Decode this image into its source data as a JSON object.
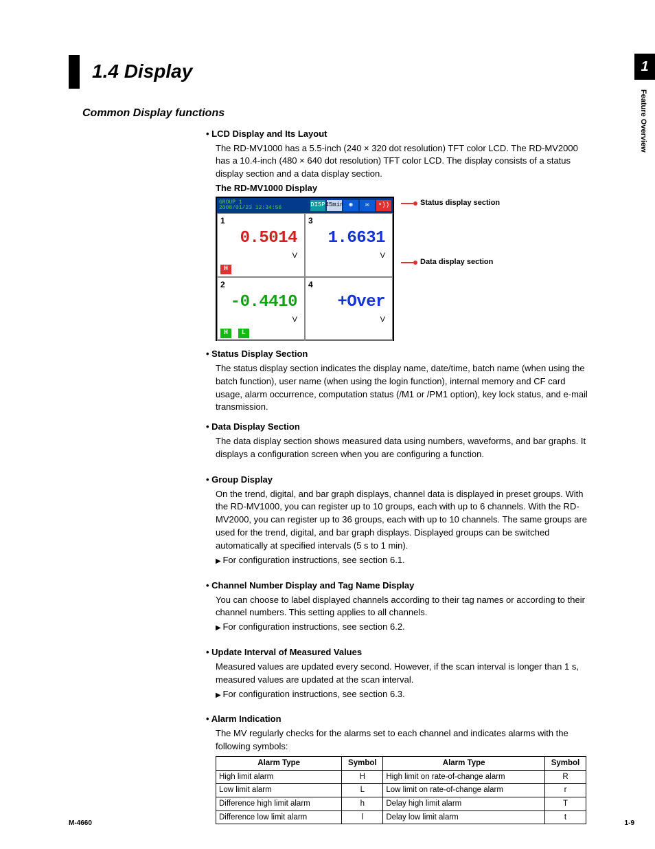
{
  "chapter_tab": "1",
  "side_label": "Feature Overview",
  "title": "1.4   Display",
  "section_heading": "Common Display functions",
  "lcd": {
    "heading": "LCD Display and Its Layout",
    "body": "The RD-MV1000 has a 5.5-inch (240 × 320 dot resolution) TFT color LCD. The RD-MV2000 has a 10.4-inch (480 × 640 dot resolution) TFT color LCD. The display consists of a status display section and a data display section.",
    "figure_label": "The RD-MV1000 Display",
    "callout_status": "Status display section",
    "callout_data": "Data display section",
    "status_group": "GROUP 1",
    "status_datetime": "2008/01/23 12:34:56",
    "status_mode": "DISP",
    "status_time": "45min",
    "cells": [
      {
        "ch": "1",
        "val": "0.5014",
        "unit": "V",
        "cls": "c-red",
        "badges": [
          {
            "t": "H",
            "c": "b-red"
          }
        ]
      },
      {
        "ch": "3",
        "val": "1.6631",
        "unit": "V",
        "cls": "c-blue",
        "badges": []
      },
      {
        "ch": "2",
        "val": "-0.4410",
        "unit": "V",
        "cls": "c-grn",
        "badges": [
          {
            "t": "H",
            "c": "b-grn"
          },
          {
            "t": "L",
            "c": "b-grn"
          }
        ]
      },
      {
        "ch": "4",
        "val": "+Over",
        "unit": "V",
        "cls": "c-blue",
        "badges": []
      }
    ]
  },
  "status_sec": {
    "heading": "Status Display Section",
    "body": "The status display section indicates the display name, date/time, batch name (when using the batch function), user name (when using the login function), internal memory and CF card usage, alarm occurrence, computation status (/M1 or /PM1 option), key lock status, and e-mail transmission."
  },
  "data_sec": {
    "heading": "Data Display Section",
    "body": "The data display section shows measured data using numbers, waveforms, and bar graphs. It displays a configuration screen when you are configuring a function."
  },
  "group_sec": {
    "heading": "Group Display",
    "body": "On the trend, digital, and bar graph displays, channel data is displayed in preset groups. With the RD-MV1000, you can register up to 10 groups, each with up to 6 channels. With the RD-MV2000, you can register up to 36 groups, each with up to 10 channels. The same groups are used for the trend, digital, and bar graph displays. Displayed groups can be switched automatically at specified intervals (5 s to 1 min).",
    "ref": "For configuration instructions, see section 6.1."
  },
  "tag_sec": {
    "heading": "Channel Number Display and Tag Name Display",
    "body": "You can choose to label displayed channels according to their tag names or according to their channel numbers. This setting applies to all channels.",
    "ref": "For configuration instructions, see section 6.2."
  },
  "update_sec": {
    "heading": "Update Interval of Measured Values",
    "body": "Measured values are updated every second. However, if the scan interval is longer than 1 s, measured values are updated at the scan interval.",
    "ref": "For configuration instructions, see section 6.3."
  },
  "alarm_sec": {
    "heading": "Alarm Indication",
    "body": "The MV regularly checks for the alarms set to each channel and indicates alarms with the following symbols:",
    "th1": "Alarm Type",
    "th2": "Symbol",
    "th3": "Alarm Type",
    "th4": "Symbol",
    "rows": [
      {
        "a": "High limit alarm",
        "as": "H",
        "b": "High limit on rate-of-change alarm",
        "bs": "R"
      },
      {
        "a": "Low limit alarm",
        "as": "L",
        "b": "Low limit on rate-of-change alarm",
        "bs": "r"
      },
      {
        "a": "Difference high limit alarm",
        "as": "h",
        "b": "Delay high limit alarm",
        "bs": "T"
      },
      {
        "a": "Difference low limit alarm",
        "as": "l",
        "b": "Delay low limit alarm",
        "bs": "t"
      }
    ]
  },
  "footer_left": "M-4660",
  "footer_right": "1-9"
}
